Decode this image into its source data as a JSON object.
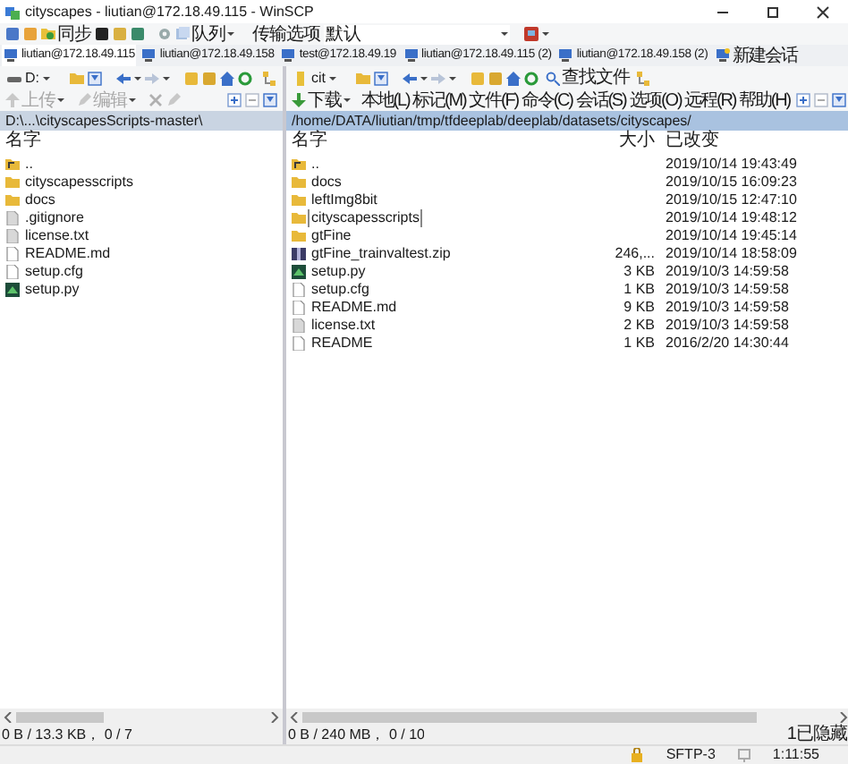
{
  "window": {
    "title": "cityscapes - liutian@172.18.49.115 - WinSCP"
  },
  "toolbar": {
    "sync_label": "同步",
    "queue_label": "队列",
    "transfer_label": "传输选项",
    "transfer_value": "默认"
  },
  "session_tabs": [
    {
      "label": "liutian@172.18.49.115",
      "kind": "session",
      "selected": true
    },
    {
      "label": "liutian@172.18.49.158",
      "kind": "session",
      "selected": false
    },
    {
      "label": "test@172.18.49.19",
      "kind": "session",
      "selected": false
    },
    {
      "label": "liutian@172.18.49.115 (2)",
      "kind": "session",
      "selected": false
    },
    {
      "label": "liutian@172.18.49.158 (2)",
      "kind": "session",
      "selected": false
    },
    {
      "label": "新建会话",
      "kind": "new",
      "selected": false
    }
  ],
  "local_panel": {
    "drive": "D:",
    "actions": [
      {
        "label": "上传",
        "disabled": true
      },
      {
        "label": "编辑",
        "disabled": true
      }
    ],
    "path": "D:\\...\\cityscapesScripts-master\\",
    "columns": [
      "名字"
    ],
    "files": [
      {
        "name": "..",
        "kind": "parent"
      },
      {
        "name": "cityscapesscripts",
        "kind": "folder"
      },
      {
        "name": "docs",
        "kind": "folder"
      },
      {
        "name": ".gitignore",
        "kind": "text"
      },
      {
        "name": "license.txt",
        "kind": "text"
      },
      {
        "name": "README.md",
        "kind": "document"
      },
      {
        "name": "setup.cfg",
        "kind": "document"
      },
      {
        "name": "setup.py",
        "kind": "python"
      }
    ],
    "status": "0 B / 13.3 KB，  0 / 7"
  },
  "remote_panel": {
    "drive": "cit",
    "find_label": "查找文件",
    "download_label": "下载",
    "menu": [
      "本地(L)",
      "标记(M)",
      "文件(F)",
      "命令(C)",
      "会话(S)",
      "选项(O)",
      "远程(R)",
      "帮助(H)"
    ],
    "path": "/home/DATA/liutian/tmp/tfdeeplab/deeplab/datasets/cityscapes/",
    "columns": [
      "名字",
      "大小",
      "已改变"
    ],
    "files": [
      {
        "name": "..",
        "kind": "parent",
        "modified": "2019/10/14 19:43:49",
        "focused": false
      },
      {
        "name": "docs",
        "kind": "folder",
        "modified": "2019/10/15 16:09:23",
        "focused": false
      },
      {
        "name": "leftImg8bit",
        "kind": "folder",
        "modified": "2019/10/15 12:47:10",
        "focused": false
      },
      {
        "name": "cityscapesscripts",
        "kind": "folder",
        "modified": "2019/10/14 19:48:12",
        "focused": true
      },
      {
        "name": "gtFine",
        "kind": "folder",
        "modified": "2019/10/14 19:45:14",
        "focused": false
      },
      {
        "name": "gtFine_trainvaltest.zip",
        "kind": "zip",
        "size": "246,...",
        "modified": "2019/10/14 18:58:09",
        "focused": false
      },
      {
        "name": "setup.py",
        "kind": "python",
        "size": "3 KB",
        "modified": "2019/10/3 14:59:58",
        "focused": false
      },
      {
        "name": "setup.cfg",
        "kind": "document",
        "size": "1 KB",
        "modified": "2019/10/3 14:59:58",
        "focused": false
      },
      {
        "name": "README.md",
        "kind": "document",
        "size": "9 KB",
        "modified": "2019/10/3 14:59:58",
        "focused": false
      },
      {
        "name": "license.txt",
        "kind": "text",
        "size": "2 KB",
        "modified": "2019/10/3 14:59:58",
        "focused": false
      },
      {
        "name": "README",
        "kind": "document",
        "size": "1 KB",
        "modified": "2016/2/20 14:30:44",
        "focused": false
      }
    ],
    "status": "0 B / 240 MB，  0 / 10",
    "hidden": "1已隐藏"
  },
  "status_bar": {
    "protocol": "SFTP-3",
    "time": "1:11:55"
  }
}
